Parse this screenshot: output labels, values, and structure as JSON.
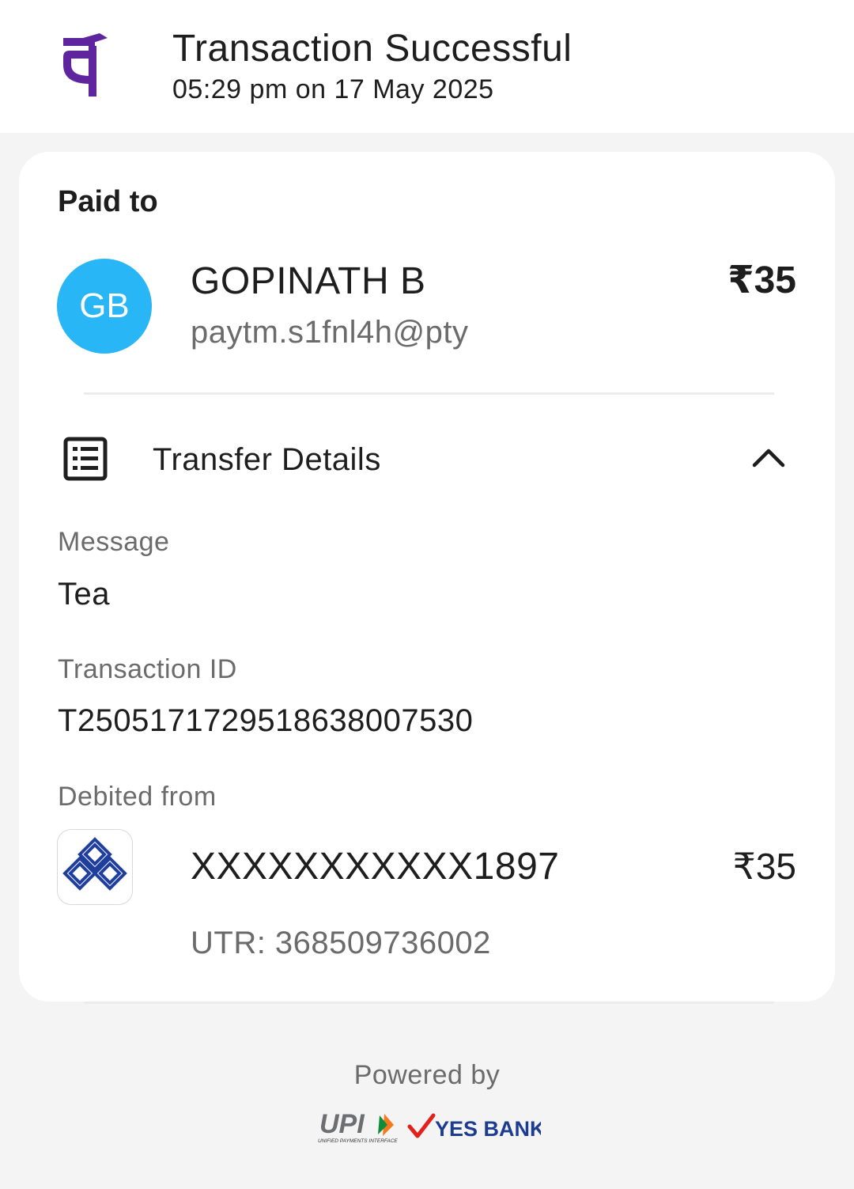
{
  "header": {
    "logo_icon": "phonepe-logo-icon",
    "title": "Transaction Successful",
    "timestamp": "05:29 pm on 17 May 2025"
  },
  "payee": {
    "section_label": "Paid to",
    "avatar_initials": "GB",
    "avatar_color": "#29b6f6",
    "name": "GOPINATH B",
    "vpa": "paytm.s1fnl4h@pty",
    "amount": "₹35"
  },
  "transfer_details": {
    "icon": "receipt-list-icon",
    "title": "Transfer Details",
    "expanded": true,
    "toggle_icon": "chevron-up-icon",
    "message_label": "Message",
    "message_value": "Tea",
    "transaction_id_label": "Transaction ID",
    "transaction_id_value": "T2505171729518638007530",
    "debited_from_label": "Debited from",
    "bank_icon": "bank-logo-icon",
    "account_number": "XXXXXXXXXXX1897",
    "debit_amount": "₹35",
    "utr": "UTR: 368509736002"
  },
  "footer": {
    "powered_by": "Powered by",
    "upi_logo": "upi-logo",
    "upi_logo_text": "UPI",
    "upi_logo_subtext": "UNIFIED PAYMENTS INTERFACE",
    "bank_partner_logo": "yes-bank-logo",
    "bank_partner_text": "YES BANK"
  },
  "colors": {
    "brand_purple": "#5f259f",
    "bank_blue": "#1f3f9a",
    "yes_bank_red": "#e2211c",
    "yes_bank_blue": "#1b3c8f"
  }
}
